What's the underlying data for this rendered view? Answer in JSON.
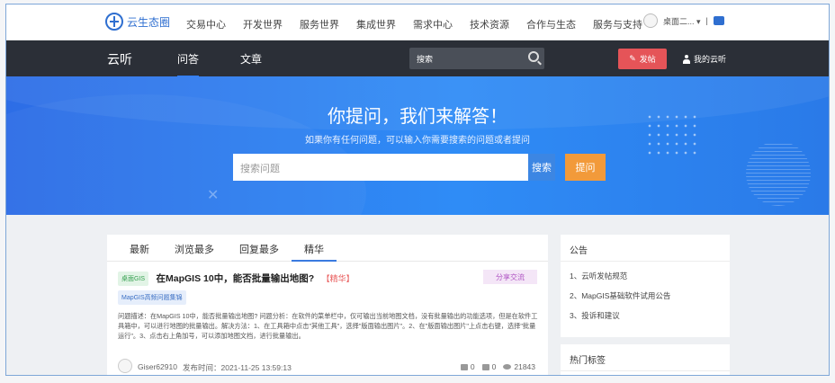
{
  "topnav": {
    "logo_text": "云生态圈",
    "menu": [
      "交易中心",
      "开发世界",
      "服务世界",
      "集成世界",
      "需求中心",
      "技术资源",
      "合作与生态",
      "服务与支持"
    ],
    "user_text": "桌面二... ▾",
    "divider": "|"
  },
  "darknav": {
    "brand": "云听",
    "tabs": [
      "问答",
      "文章"
    ],
    "search_placeholder": "搜索",
    "post_label": "发帖",
    "my_label": "我的云听"
  },
  "hero": {
    "title": "你提问，我们来解答！",
    "subtitle": "如果你有任何问题，可以输入你需要搜索的问题或者提问",
    "input_placeholder": "搜索问题",
    "search_label": "搜索",
    "ask_label": "提问"
  },
  "main": {
    "tabs": [
      "最新",
      "浏览最多",
      "回复最多",
      "精华"
    ],
    "active_tab": "精华",
    "question": {
      "category": "桌面GIS",
      "title": "在MapGIS 10中，能否批量输出地图?",
      "flag": "【精华】",
      "share": "分享交流",
      "tag": "MapGIS高频问题集锦",
      "desc": "问题描述：在MapGIS 10中，能否批量输出地图? 问题分析：在软件的菜单栏中，仅可输出当前地图文档，没有批量输出的功能选项，但是在软件工具箱中，可以进行地图的批量输出。解决方法：1、在工具箱中点击\"其他工具\"，选择\"版面输出图片\"。2、在\"版面输出图片\"上点击右键，选择\"批量运行\"。3、点击右上角加号，可以添加地图文档，进行批量输出。",
      "user": "Giser62910",
      "time": "发布时间：2021-11-25 13:59:13",
      "likes": "0",
      "comments": "0",
      "views": "21843"
    }
  },
  "sidebar": {
    "notice_title": "公告",
    "notices": [
      "1、云听发帖规范",
      "2、MapGIS基础软件试用公告",
      "3、投诉和建议"
    ],
    "hot_tags_title": "热门标签"
  },
  "colors": {
    "accent": "#2f7cf0",
    "dark_nav": "#2b2f37",
    "post_button": "#e55458",
    "ask_button": "#f29a3a"
  }
}
